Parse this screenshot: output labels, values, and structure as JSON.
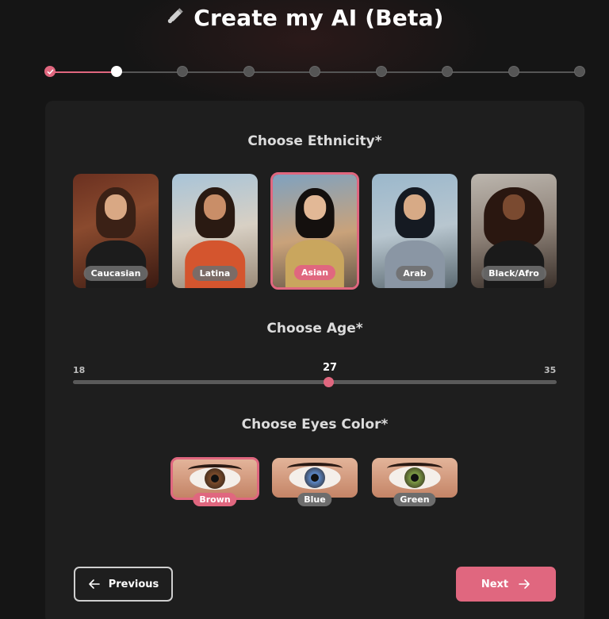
{
  "header": {
    "title": "Create my AI (Beta)",
    "icon": "pen-icon"
  },
  "stepper": {
    "total_steps": 9,
    "completed_steps": 1,
    "current_step": 2
  },
  "colors": {
    "accent": "#e0677f",
    "background": "#151515",
    "card": "#1e1e1e"
  },
  "ethnicity": {
    "title": "Choose Ethnicity*",
    "options": [
      {
        "label": "Caucasian",
        "selected": false
      },
      {
        "label": "Latina",
        "selected": false
      },
      {
        "label": "Asian",
        "selected": true
      },
      {
        "label": "Arab",
        "selected": false
      },
      {
        "label": "Black/Afro",
        "selected": false
      }
    ]
  },
  "age": {
    "title": "Choose Age*",
    "min": "18",
    "max": "35",
    "value": "27"
  },
  "eyes": {
    "title": "Choose Eyes Color*",
    "options": [
      {
        "label": "Brown",
        "selected": true,
        "iris_color": "#7a4a2a"
      },
      {
        "label": "Blue",
        "selected": false,
        "iris_color": "#5b86c4"
      },
      {
        "label": "Green",
        "selected": false,
        "iris_color": "#7c9a45"
      }
    ]
  },
  "nav": {
    "previous_label": "Previous",
    "next_label": "Next"
  }
}
